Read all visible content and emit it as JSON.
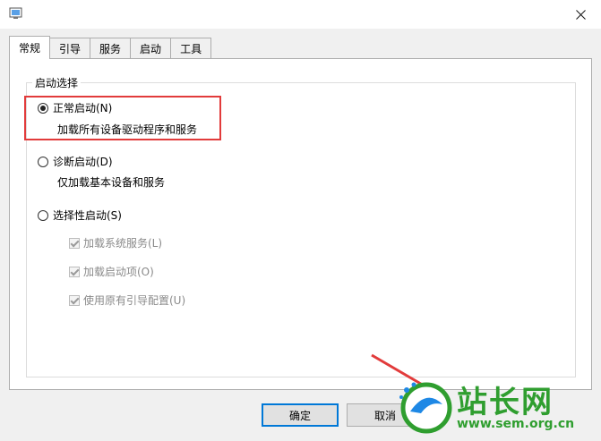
{
  "tabs": [
    {
      "label": "常规",
      "active": true
    },
    {
      "label": "引导",
      "active": false
    },
    {
      "label": "服务",
      "active": false
    },
    {
      "label": "启动",
      "active": false
    },
    {
      "label": "工具",
      "active": false
    }
  ],
  "group": {
    "title": "启动选择"
  },
  "options": {
    "normal": {
      "label": "正常启动(N)",
      "desc": "加载所有设备驱动程序和服务",
      "checked": true
    },
    "diagnostic": {
      "label": "诊断启动(D)",
      "desc": "仅加载基本设备和服务",
      "checked": false
    },
    "selective": {
      "label": "选择性启动(S)",
      "checked": false
    }
  },
  "selective_items": [
    {
      "label": "加载系统服务(L)",
      "checked": true
    },
    {
      "label": "加载启动项(O)",
      "checked": true
    },
    {
      "label": "使用原有引导配置(U)",
      "checked": true
    }
  ],
  "buttons": {
    "ok": "确定",
    "cancel": "取消"
  },
  "watermark": {
    "brand": "站长网",
    "url": "www.sem.org.cn"
  },
  "colors": {
    "highlight": "#e23b3b",
    "accent": "#0078d7",
    "watermark": "#2f9e2f"
  },
  "icons": {
    "app": "msconfig-icon",
    "close": "close-icon"
  }
}
